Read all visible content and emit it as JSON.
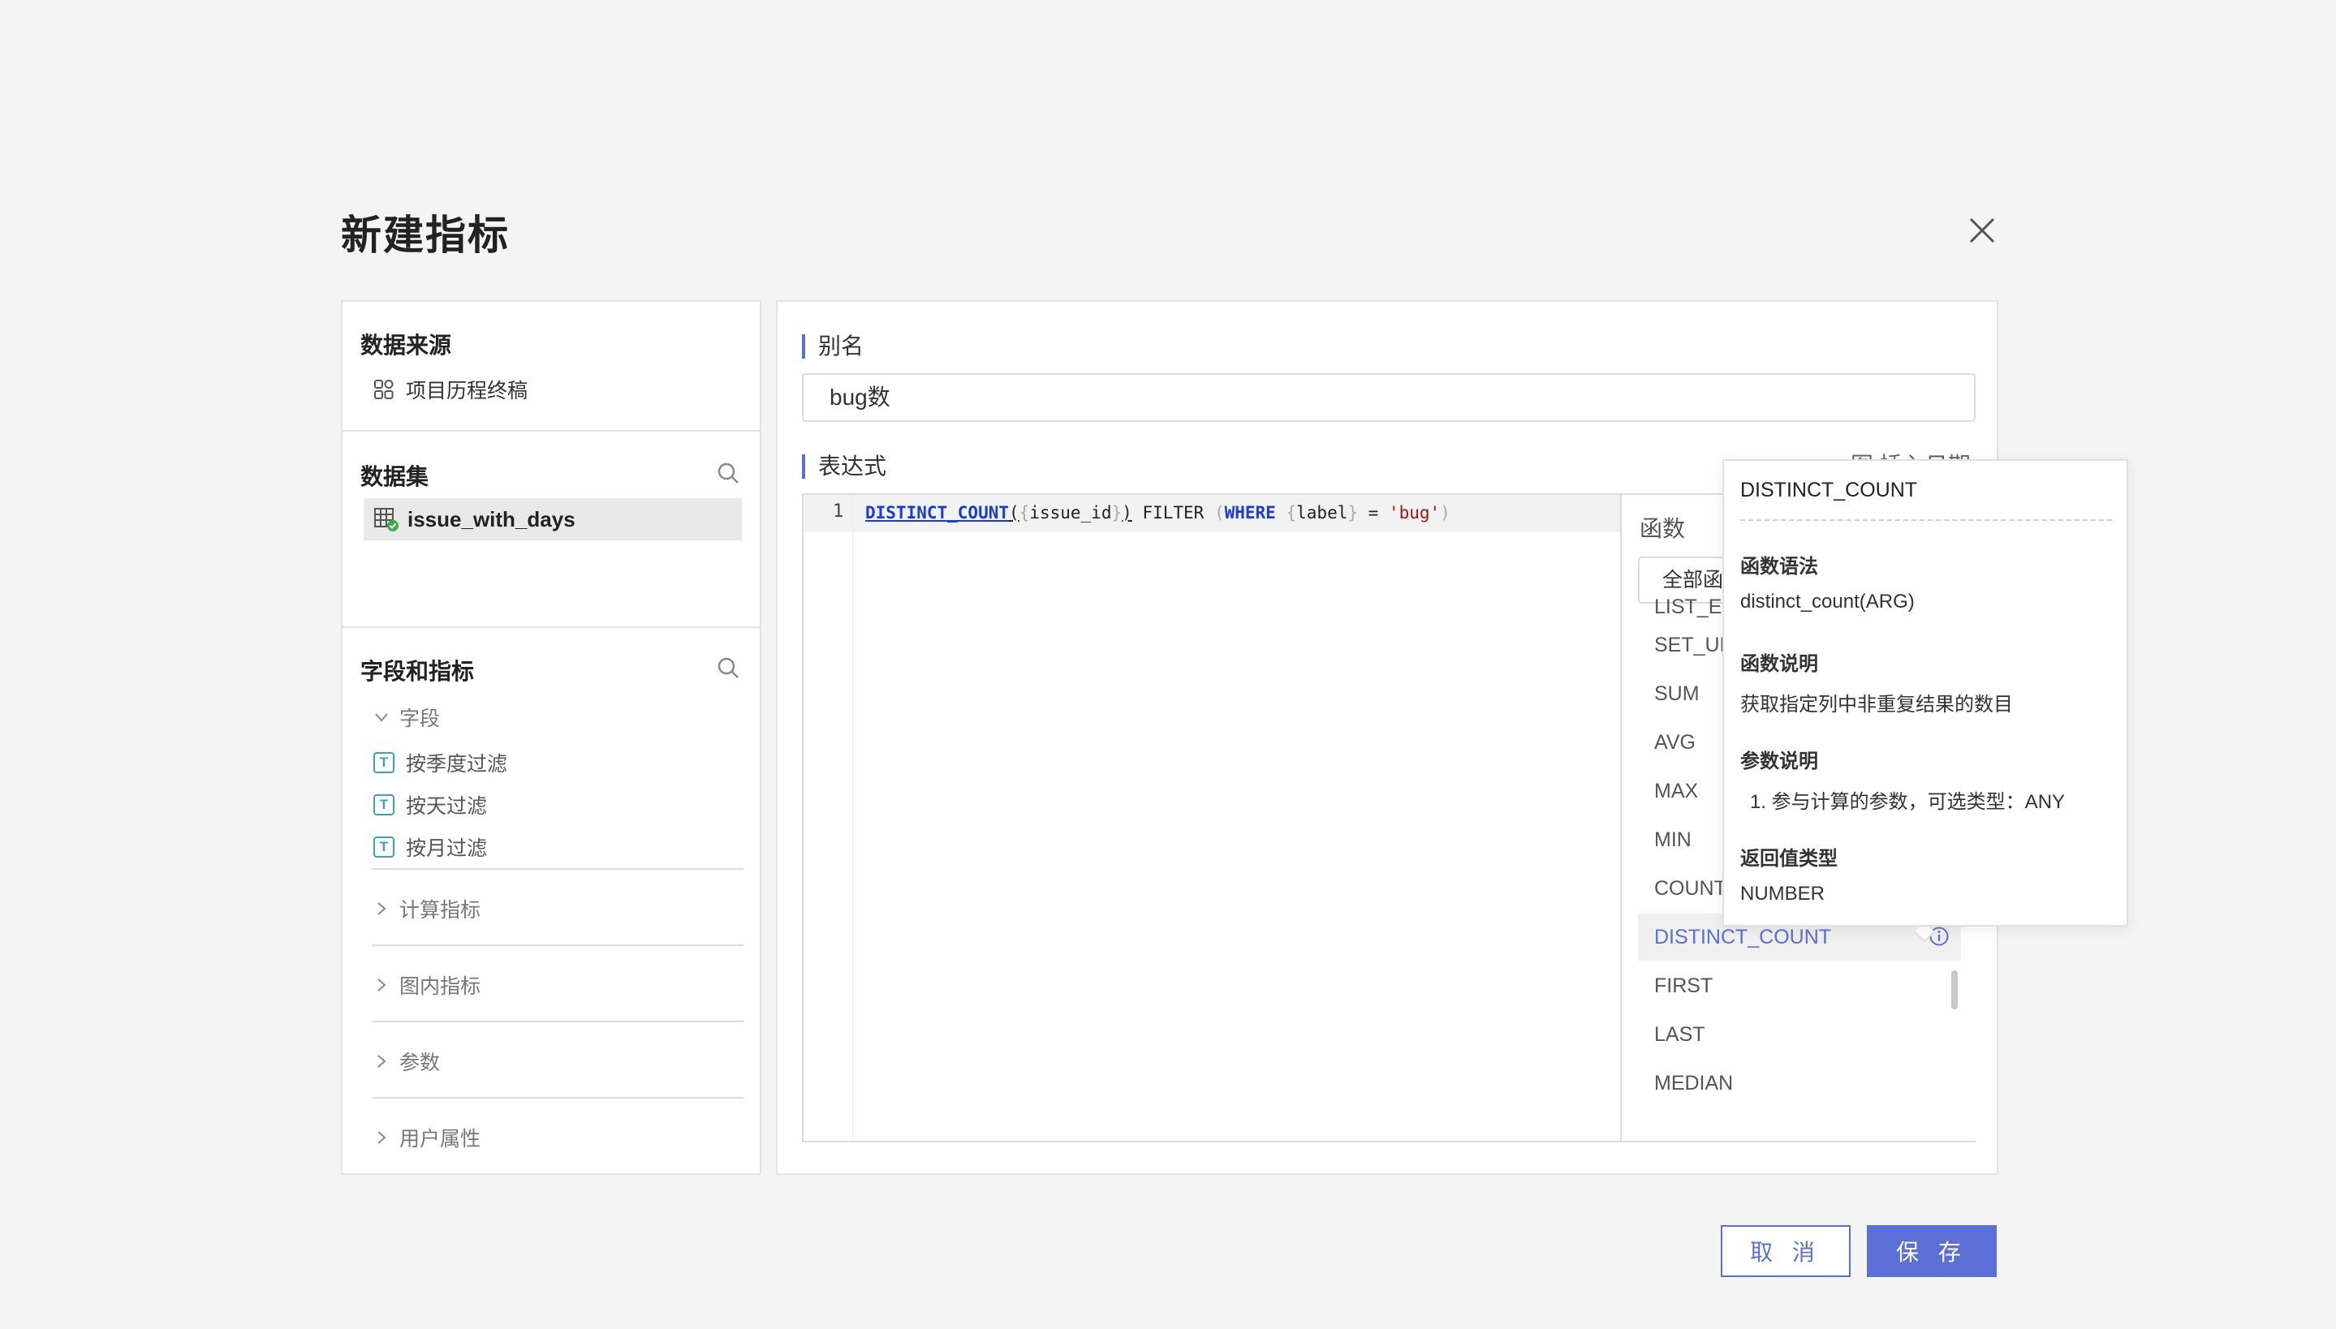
{
  "dialog": {
    "title": "新建指标",
    "cancel_label": "取 消",
    "save_label": "保 存"
  },
  "left_panel": {
    "data_source": {
      "header": "数据来源",
      "item": "项目历程终稿"
    },
    "dataset": {
      "header": "数据集",
      "item": "issue_with_days"
    },
    "fields": {
      "header": "字段和指标",
      "groups": [
        {
          "label": "字段",
          "expanded": true,
          "items": [
            "按季度过滤",
            "按天过滤",
            "按月过滤"
          ]
        },
        {
          "label": "计算指标",
          "expanded": false
        },
        {
          "label": "图内指标",
          "expanded": false
        },
        {
          "label": "参数",
          "expanded": false
        },
        {
          "label": "用户属性",
          "expanded": false
        }
      ]
    }
  },
  "right_panel": {
    "alias": {
      "label": "别名",
      "value": "bug数"
    },
    "expression": {
      "label": "表达式",
      "extra": "图 插入日期",
      "line_number": "1",
      "code": {
        "fn": "DISTINCT_COUNT",
        "p1": "(",
        "b1": "{",
        "f1": "issue_id",
        "b2": "}",
        "p2": ")",
        "filter": " FILTER ",
        "p3": "(",
        "where": "WHERE",
        "b3": "{",
        "f2": "label",
        "b4": "}",
        "eq": " = ",
        "str": "'bug'",
        "p4": ")"
      }
    },
    "functions": {
      "title": "函数",
      "select_value": "全部函数",
      "list": [
        "LIST_EXTRACT",
        "SET_UNION",
        "SUM",
        "AVG",
        "MAX",
        "MIN",
        "COUNT",
        "DISTINCT_COUNT",
        "FIRST",
        "LAST",
        "MEDIAN"
      ],
      "selected": "DISTINCT_COUNT"
    }
  },
  "tooltip": {
    "name": "DISTINCT_COUNT",
    "syntax_label": "函数语法",
    "syntax": "distinct_count(ARG)",
    "desc_label": "函数说明",
    "desc": "获取指定列中非重复结果的数目",
    "params_label": "参数说明",
    "params": "1. 参与计算的参数，可选类型：ANY",
    "return_label": "返回值类型",
    "return": "NUMBER"
  },
  "colors": {
    "accent": "#5b6fd6",
    "field_icon": "#3aa3b8",
    "keyword": "#1a3cd1",
    "string": "#a31515"
  }
}
